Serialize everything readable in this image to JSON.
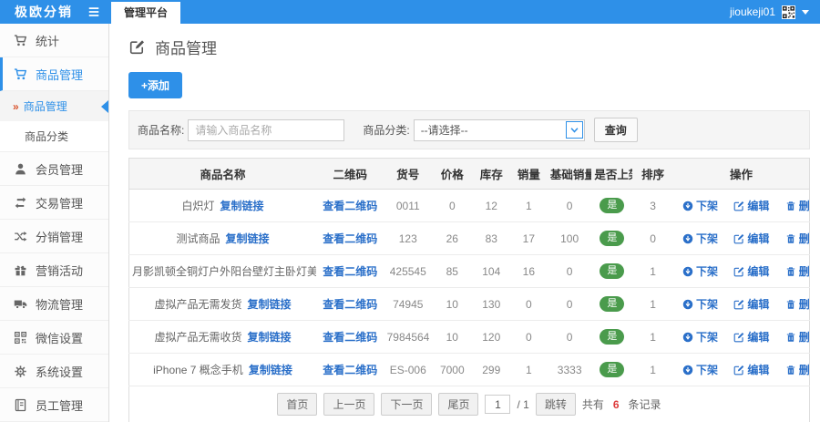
{
  "colors": {
    "accent": "#2e90e8",
    "link": "#2a6fc9",
    "success": "#4a9b4c",
    "danger": "#dd3a3a"
  },
  "topbar": {
    "brand": "极欧分销",
    "tab": "管理平台",
    "username": "jioukeji01"
  },
  "sidebar": {
    "sub_marker": "»",
    "items": [
      {
        "icon": "cart-icon",
        "label": "统计",
        "active": false
      },
      {
        "icon": "cart-icon",
        "label": "商品管理",
        "active": true,
        "children": [
          {
            "label": "商品管理",
            "active": true
          },
          {
            "label": "商品分类",
            "active": false
          }
        ]
      },
      {
        "icon": "user-icon",
        "label": "会员管理",
        "active": false
      },
      {
        "icon": "exchange-icon",
        "label": "交易管理",
        "active": false
      },
      {
        "icon": "shuffle-icon",
        "label": "分销管理",
        "active": false
      },
      {
        "icon": "gift-icon",
        "label": "营销活动",
        "active": false
      },
      {
        "icon": "truck-icon",
        "label": "物流管理",
        "active": false
      },
      {
        "icon": "qrcode-icon",
        "label": "微信设置",
        "active": false
      },
      {
        "icon": "gear-icon",
        "label": "系统设置",
        "active": false
      },
      {
        "icon": "book-icon",
        "label": "员工管理",
        "active": false
      }
    ]
  },
  "page": {
    "title": "商品管理"
  },
  "toolbar": {
    "add_label": "+添加"
  },
  "filter": {
    "name_label": "商品名称:",
    "name_placeholder": "请输入商品名称",
    "category_label": "商品分类:",
    "category_value": "--请选择--",
    "search_label": "查询"
  },
  "table": {
    "headers": [
      "商品名称",
      "二维码",
      "货号",
      "价格",
      "库存",
      "销量",
      "基础销量",
      "是否上架",
      "排序",
      "操作"
    ],
    "copy_link_label": "复制链接",
    "view_qr_label": "查看二维码",
    "actions": {
      "off_shelf": "下架",
      "edit": "编辑",
      "delete": "删除"
    },
    "rows": [
      {
        "name": "白炽灯",
        "code": "0011",
        "price": "0",
        "stock": "12",
        "sales": "1",
        "base_sales": "0",
        "on_shelf": "是",
        "sort": "3"
      },
      {
        "name": "测试商品",
        "code": "123",
        "price": "26",
        "stock": "83",
        "sales": "17",
        "base_sales": "100",
        "on_shelf": "是",
        "sort": "0"
      },
      {
        "name": "月影凯顿全铜灯户外阳台壁灯主卧灯美式田园...",
        "code": "425545",
        "price": "85",
        "stock": "104",
        "sales": "16",
        "base_sales": "0",
        "on_shelf": "是",
        "sort": "1"
      },
      {
        "name": "虚拟产品无需发货",
        "code": "74945",
        "price": "10",
        "stock": "130",
        "sales": "0",
        "base_sales": "0",
        "on_shelf": "是",
        "sort": "1"
      },
      {
        "name": "虚拟产品无需收货",
        "code": "7984564",
        "price": "10",
        "stock": "120",
        "sales": "0",
        "base_sales": "0",
        "on_shelf": "是",
        "sort": "1"
      },
      {
        "name": "iPhone 7 概念手机",
        "code": "ES-006",
        "price": "7000",
        "stock": "299",
        "sales": "1",
        "base_sales": "3333",
        "on_shelf": "是",
        "sort": "1"
      }
    ]
  },
  "pagination": {
    "first": "首页",
    "prev": "上一页",
    "next": "下一页",
    "last": "尾页",
    "page_input": "1",
    "page_total": "/ 1",
    "jump": "跳转",
    "total_prefix": "共有",
    "total_count": "6",
    "total_suffix": "条记录"
  }
}
